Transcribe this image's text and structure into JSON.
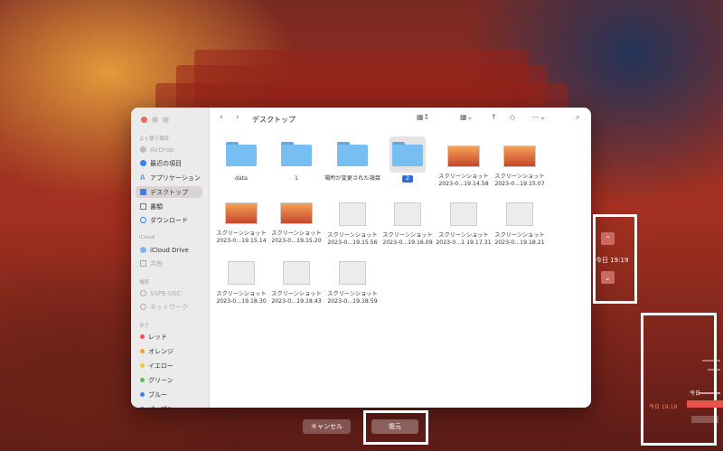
{
  "finder": {
    "title": "デスクトップ",
    "sidebar": {
      "favorites_header": "よく使う項目",
      "favorites": [
        "AirDrop",
        "最近の項目",
        "アプリケーション",
        "デスクトップ",
        "書類",
        "ダウンロード"
      ],
      "icloud_header": "iCloud",
      "icloud": [
        "iCloud Drive",
        "共有"
      ],
      "locations_header": "場所",
      "locations": [
        "SSPE-USC",
        "ネットワーク"
      ],
      "tags_header": "タグ",
      "tags": [
        {
          "label": "レッド",
          "color": "#ff4d4d"
        },
        {
          "label": "オレンジ",
          "color": "#ff9a2e"
        },
        {
          "label": "イエロー",
          "color": "#f7c531"
        },
        {
          "label": "グリーン",
          "color": "#4cc24a"
        },
        {
          "label": "ブルー",
          "color": "#3a80f0"
        },
        {
          "label": "パープル",
          "color": "#a55fd8"
        }
      ]
    },
    "items": [
      {
        "name1": "data",
        "name2": ""
      },
      {
        "name1": "1",
        "name2": ""
      },
      {
        "name1": "場所が変更された項目",
        "name2": ""
      },
      {
        "name1": "2",
        "name2": ""
      },
      {
        "name1": "スクリーンショット",
        "name2": "2023-0...19.14.58"
      },
      {
        "name1": "スクリーンショット",
        "name2": "2023-0...19.15.07"
      },
      {
        "name1": "スクリーンショット",
        "name2": "2023-0...19.15.14"
      },
      {
        "name1": "スクリーンショット",
        "name2": "2023-0...19.15.20"
      },
      {
        "name1": "スクリーンショット",
        "name2": "2023-0...19.15.56"
      },
      {
        "name1": "スクリーンショット",
        "name2": "2023-0...19.16.09"
      },
      {
        "name1": "スクリーンショット",
        "name2": "2023-0...1 19.17.31"
      },
      {
        "name1": "スクリーンショット",
        "name2": "2023-0...19.18.21"
      },
      {
        "name1": "スクリーンショット",
        "name2": "2023-0...19.18.30"
      },
      {
        "name1": "スクリーンショット",
        "name2": "2023-0...19.18.43"
      },
      {
        "name1": "スクリーンショット",
        "name2": "2023-0...19.18.59"
      }
    ]
  },
  "timemachine": {
    "nav_time": "今日 19:19",
    "timeline_today": "今日",
    "timeline_time": "今日 19:19",
    "cancel_label": "キャンセル",
    "restore_label": "復元"
  },
  "colors": {
    "accent": "#2f6fd6",
    "folder": "#77bff2",
    "timeline": "#e5534b"
  }
}
